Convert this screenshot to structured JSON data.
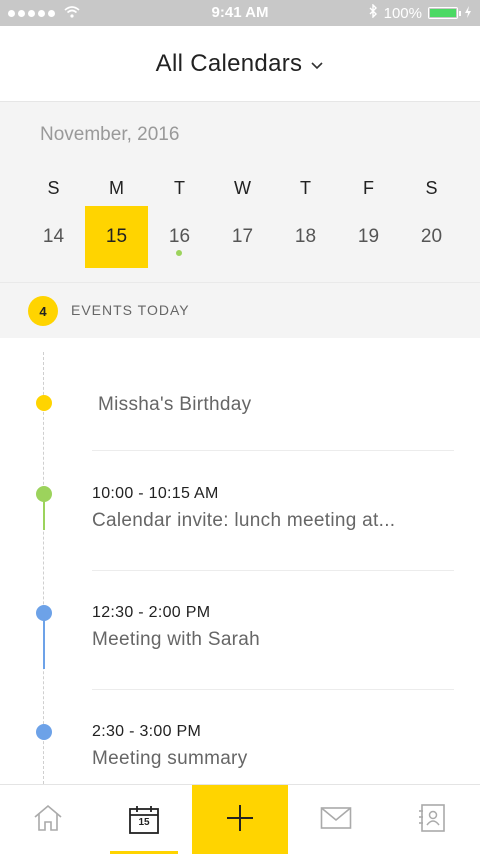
{
  "status_bar": {
    "time": "9:41 AM",
    "battery": "100%"
  },
  "header": {
    "title": "All Calendars"
  },
  "calendar": {
    "month": "November, 2016",
    "weekdays": [
      "S",
      "M",
      "T",
      "W",
      "T",
      "F",
      "S"
    ],
    "days": [
      "14",
      "15",
      "16",
      "17",
      "18",
      "19",
      "20"
    ],
    "selected_day": "15",
    "event_dot_day": "16"
  },
  "events_header": {
    "count": "4",
    "label": "EVENTS TODAY"
  },
  "events": [
    {
      "time": "",
      "title": "Missha's Birthday",
      "color": "#ffd400"
    },
    {
      "time": "10:00 - 10:15 AM",
      "title": "Calendar invite: lunch meeting at...",
      "color": "#9cd35c"
    },
    {
      "time": "12:30 - 2:00 PM",
      "title": "Meeting with Sarah",
      "color": "#6da2e8"
    },
    {
      "time": "2:30 - 3:00 PM",
      "title": "Meeting summary",
      "color": "#6da2e8"
    }
  ],
  "tabbar": {
    "calendar_icon_date": "15"
  },
  "colors": {
    "accent": "#ffd400",
    "green": "#9cd35c",
    "blue": "#6da2e8"
  }
}
